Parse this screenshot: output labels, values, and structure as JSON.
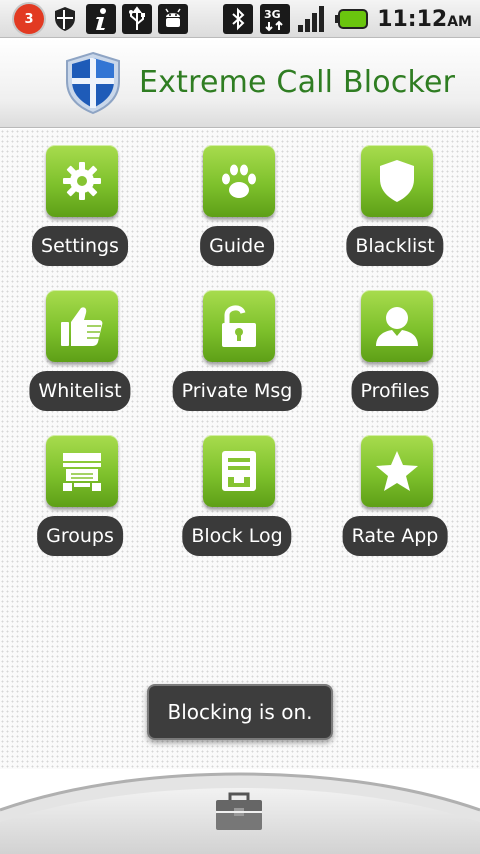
{
  "status_bar": {
    "notification_count": "3",
    "time": "11:12",
    "ampm": "AM",
    "network": "3G"
  },
  "header": {
    "title": "Extreme Call Blocker"
  },
  "menu": {
    "items": [
      {
        "label": "Settings",
        "icon": "gear-icon"
      },
      {
        "label": "Guide",
        "icon": "paw-icon"
      },
      {
        "label": "Blacklist",
        "icon": "shield-icon"
      },
      {
        "label": "Whitelist",
        "icon": "thumbs-up-icon"
      },
      {
        "label": "Private Msg",
        "icon": "unlock-icon"
      },
      {
        "label": "Profiles",
        "icon": "person-icon"
      },
      {
        "label": "Groups",
        "icon": "groups-icon"
      },
      {
        "label": "Block Log",
        "icon": "log-icon"
      },
      {
        "label": "Rate App",
        "icon": "star-icon"
      }
    ]
  },
  "toast": {
    "message": "Blocking is on."
  },
  "colors": {
    "accent_green": "#7ec12c",
    "title_green": "#2f7d22",
    "label_bg": "#3a3a3a"
  }
}
